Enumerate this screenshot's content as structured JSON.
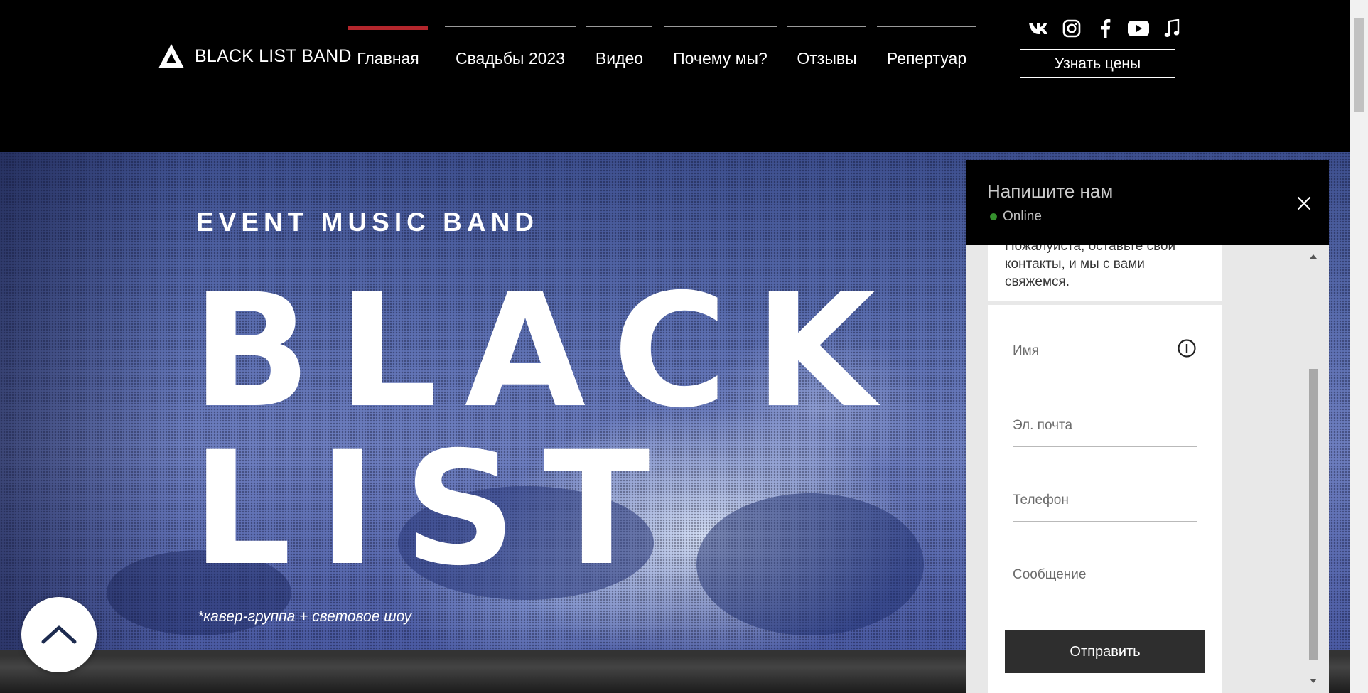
{
  "header": {
    "logo_text": "BLACK LIST BAND",
    "nav": [
      {
        "label": "Главная",
        "active": true
      },
      {
        "label": "Свадьбы 2023",
        "active": false
      },
      {
        "label": "Видео",
        "active": false
      },
      {
        "label": "Почему мы?",
        "active": false
      },
      {
        "label": "Отзывы",
        "active": false
      },
      {
        "label": "Репертуар",
        "active": false
      }
    ],
    "socials": [
      "vk-icon",
      "instagram-icon",
      "facebook-icon",
      "youtube-icon",
      "music-note-icon"
    ],
    "price_button": "Узнать цены",
    "accent_color": "#b3262c"
  },
  "hero": {
    "tagline": "EVENT MUSIC BAND",
    "big_line_1": "BLACK",
    "big_line_2": "LIST",
    "subtitle": "*кавер-группа + световое шоу"
  },
  "chat": {
    "title": "Напишите нам",
    "status": "Online",
    "status_color": "#47c13d",
    "intro_text": "Пожалуйста, оставьте свои контакты, и мы с вами свяжемся.",
    "fields": {
      "name": "Имя",
      "email": "Эл. почта",
      "phone": "Телефон",
      "message": "Сообщение"
    },
    "send_button": "Отправить"
  }
}
